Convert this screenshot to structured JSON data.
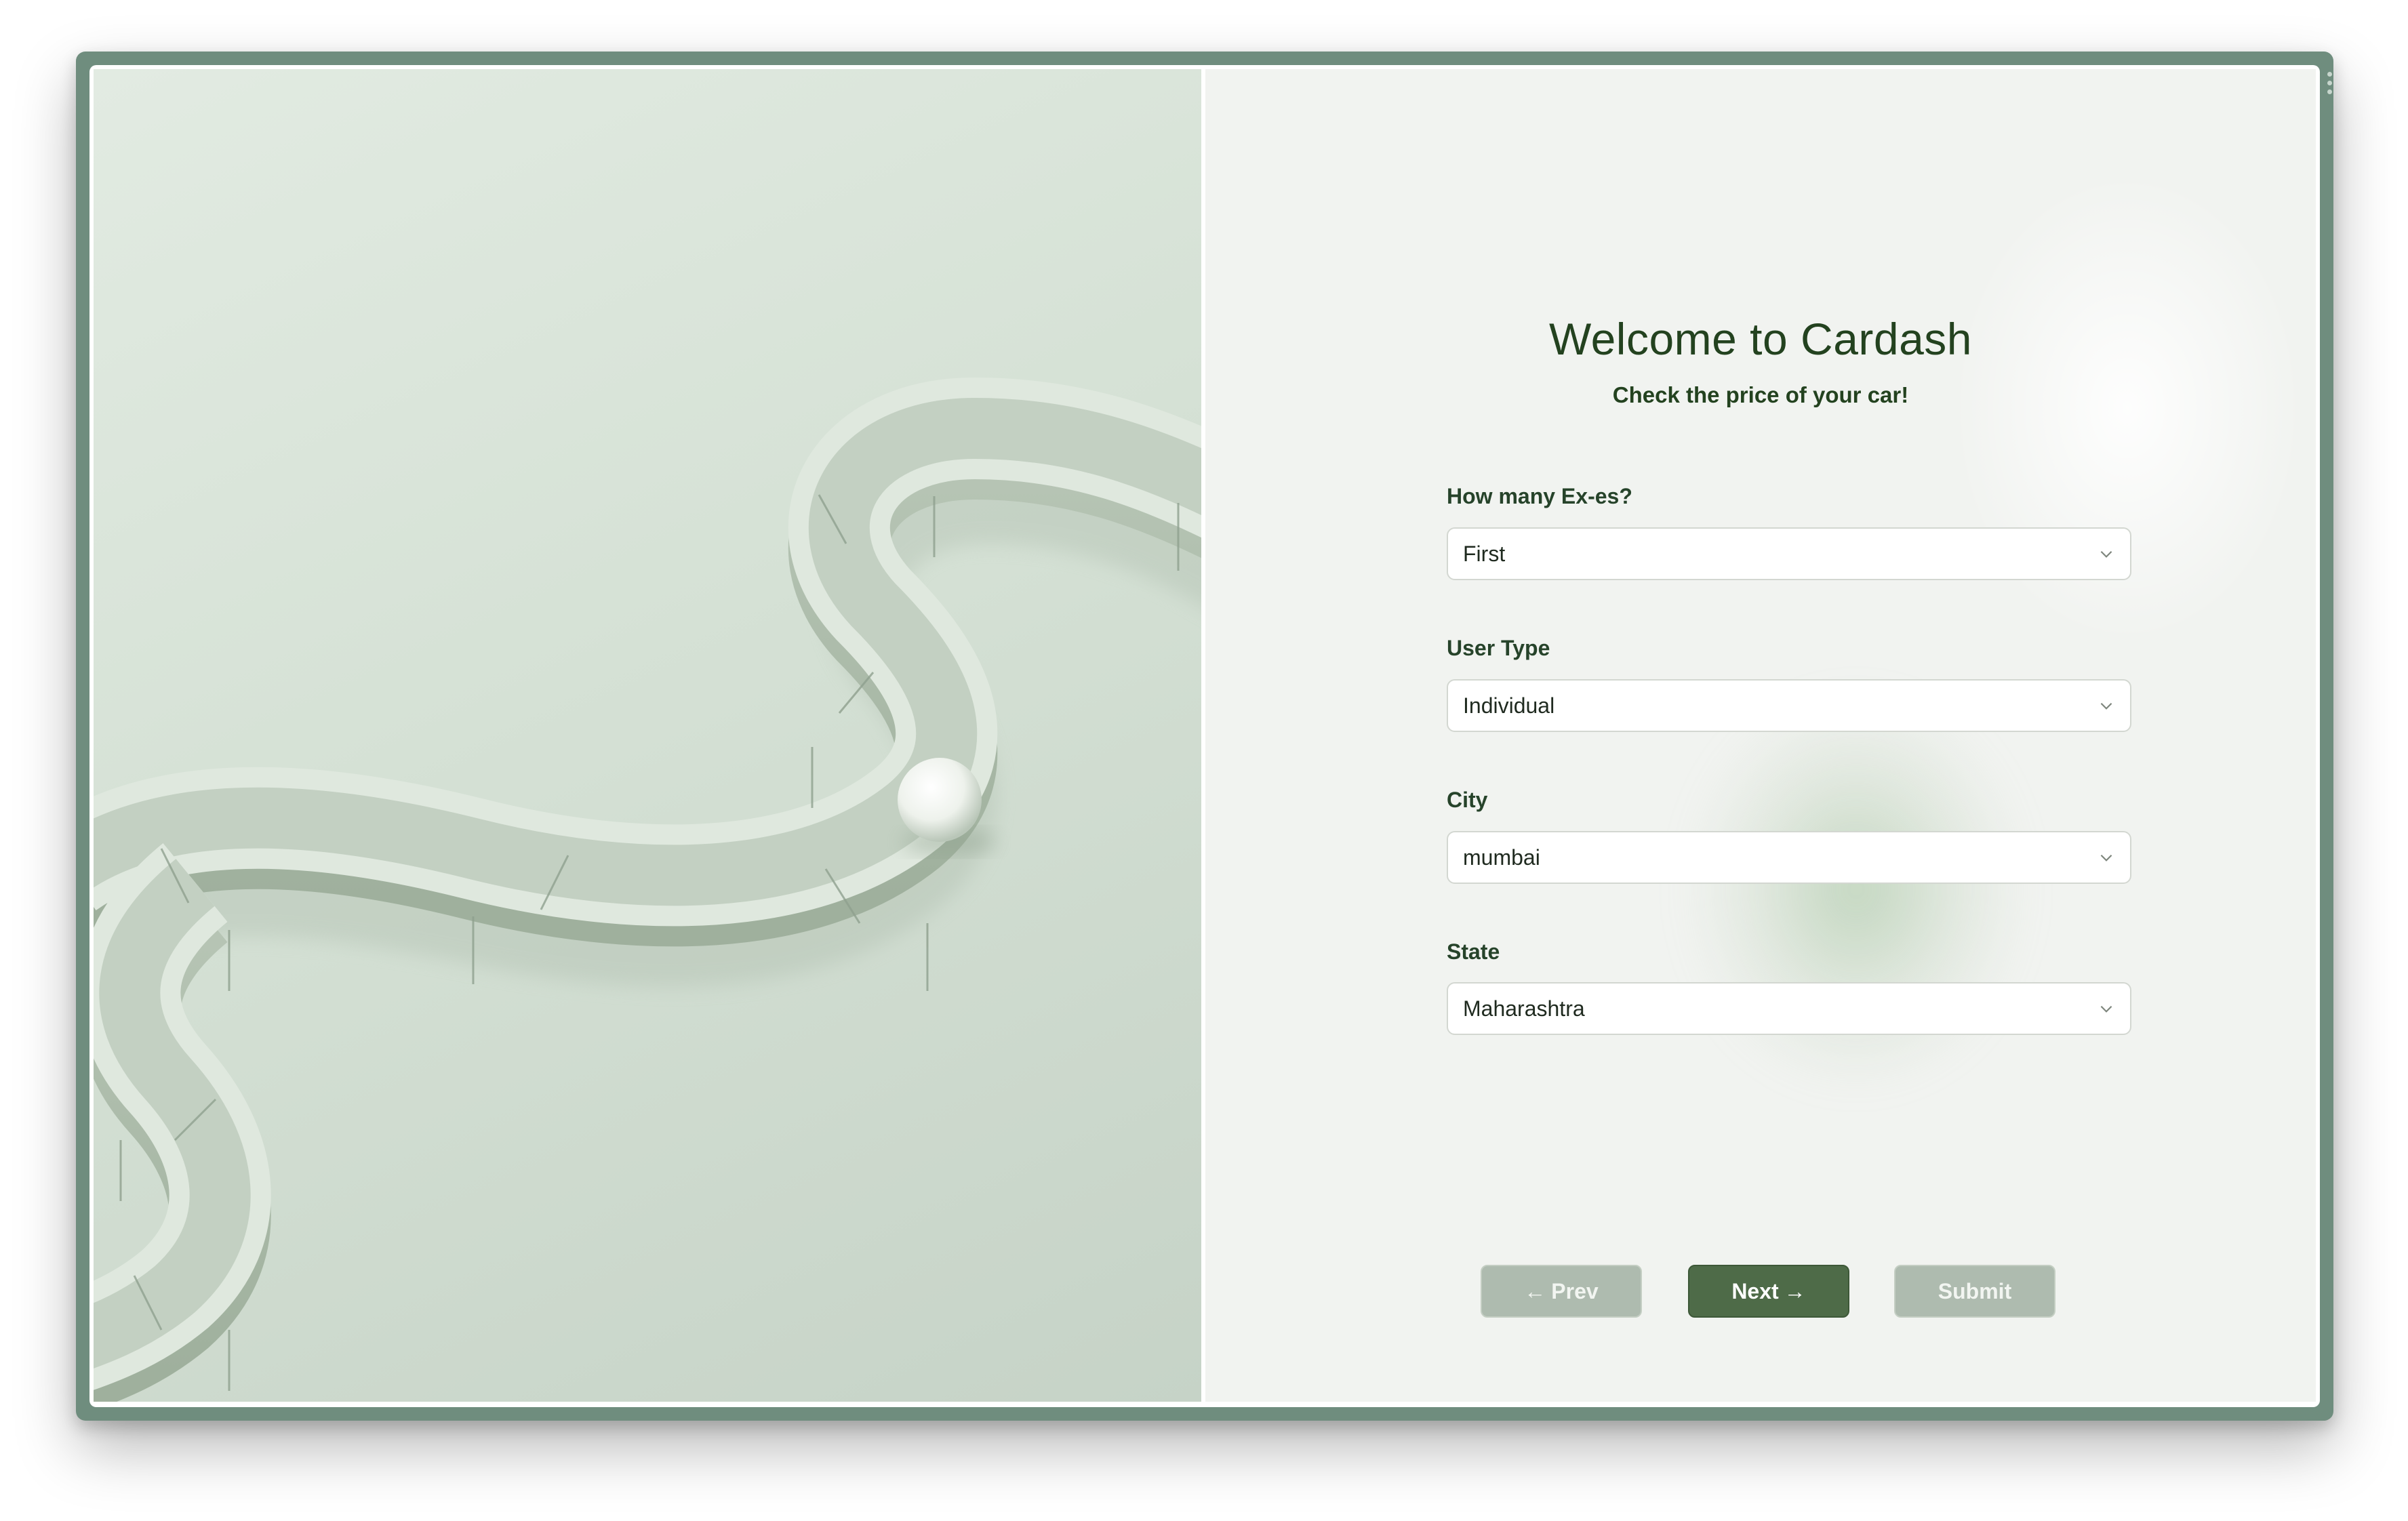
{
  "header": {
    "title": "Welcome to Cardash",
    "subtitle": "Check the price of your car!"
  },
  "form": {
    "fields": [
      {
        "label": "How many Ex-es?",
        "value": "First",
        "icon": "chevron-down-icon"
      },
      {
        "label": "User Type",
        "value": "Individual",
        "icon": "chevron-down-icon"
      },
      {
        "label": "City",
        "value": "mumbai",
        "icon": "chevron-down-icon"
      },
      {
        "label": "State",
        "value": "Maharashtra",
        "icon": "chevron-down-icon"
      }
    ]
  },
  "buttons": {
    "prev": {
      "arrow": "←",
      "label": "Prev",
      "icon": "arrow-left-icon"
    },
    "next": {
      "label": "Next",
      "arrow": "→",
      "icon": "arrow-right-icon"
    },
    "submit": {
      "label": "Submit"
    }
  },
  "colors": {
    "frame": "#6f8d7e",
    "primary": "#4e6b48",
    "disabled": "#aebbaf",
    "text_dark": "#23421f",
    "panel_bg": "#f1f3f0"
  }
}
